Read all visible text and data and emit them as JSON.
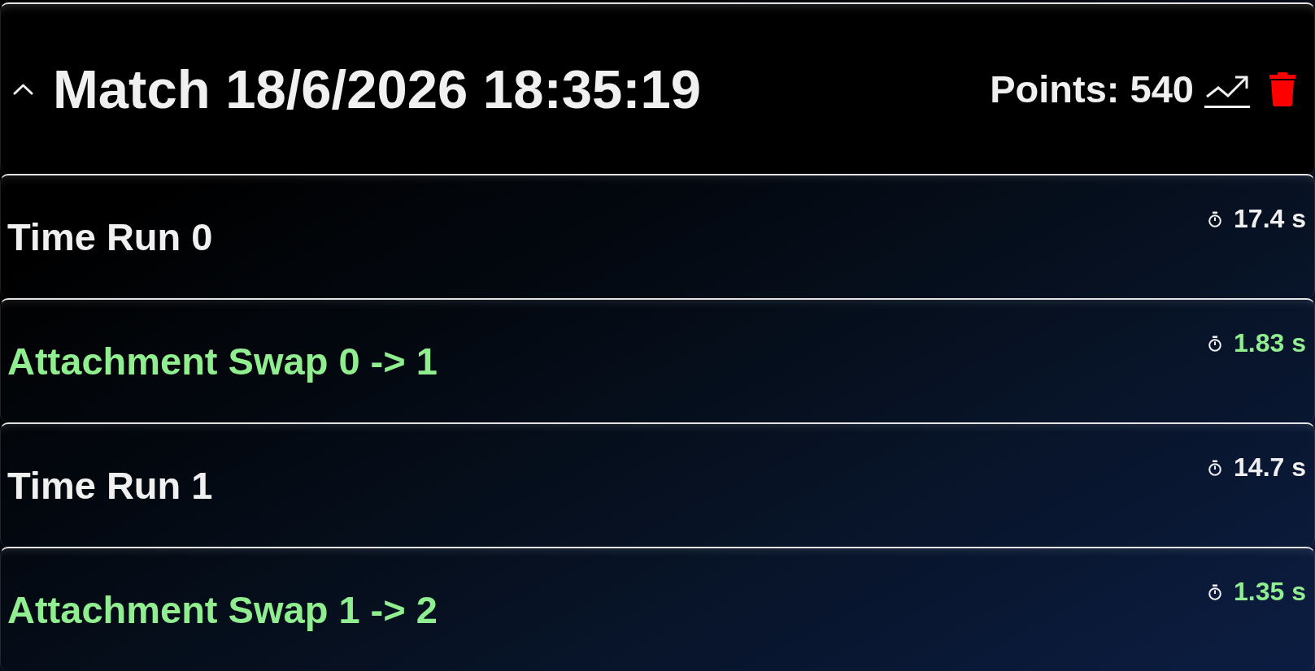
{
  "match": {
    "title": "Match 18/6/2026 18:35:19",
    "expanded": true,
    "points": "Points: 540"
  },
  "entries": [
    {
      "kind": "run",
      "label": "Time Run 0",
      "time": "17.4 s"
    },
    {
      "kind": "swap",
      "label": "Attachment Swap 0 -> 1",
      "time": "1.83 s"
    },
    {
      "kind": "run",
      "label": "Time Run 1",
      "time": "14.7 s"
    },
    {
      "kind": "swap",
      "label": "Attachment Swap 1 -> 2",
      "time": "1.35 s"
    }
  ]
}
